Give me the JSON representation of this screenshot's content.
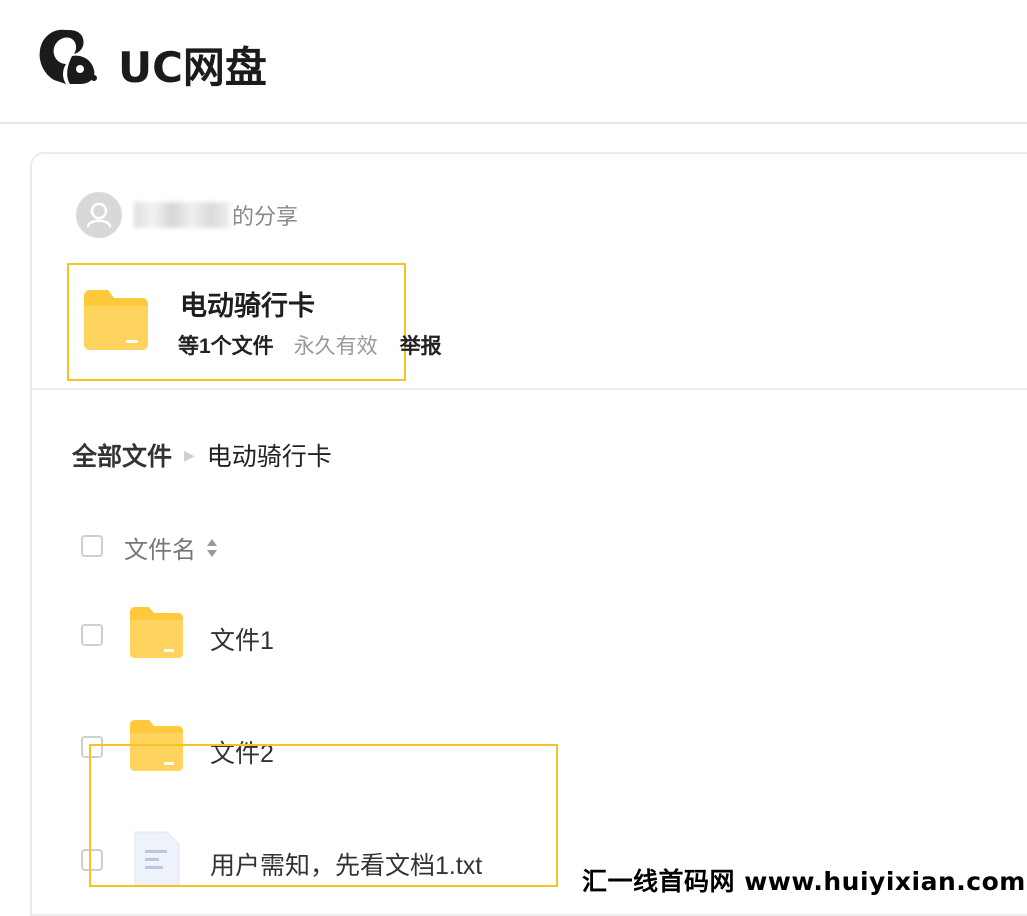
{
  "header": {
    "logo_text": "UC网盘"
  },
  "share": {
    "sharer_suffix": "的分享",
    "title": "电动骑行卡",
    "file_count": "等1个文件",
    "validity": "永久有效",
    "report_label": "举报"
  },
  "breadcrumb": {
    "root": "全部文件",
    "current": "电动骑行卡"
  },
  "file_list": {
    "column_name": "文件名",
    "rows": [
      {
        "name": "文件1",
        "type": "folder-icon"
      },
      {
        "name": "文件2",
        "type": "folder-icon"
      },
      {
        "name": "用户需知，先看文档1.txt",
        "type": "text-file-icon"
      }
    ]
  },
  "watermark": "汇一线首码网 www.huiyixian.com",
  "colors": {
    "folder": "#ffc93d",
    "highlight": "#f5c424",
    "divider": "#ececec"
  }
}
